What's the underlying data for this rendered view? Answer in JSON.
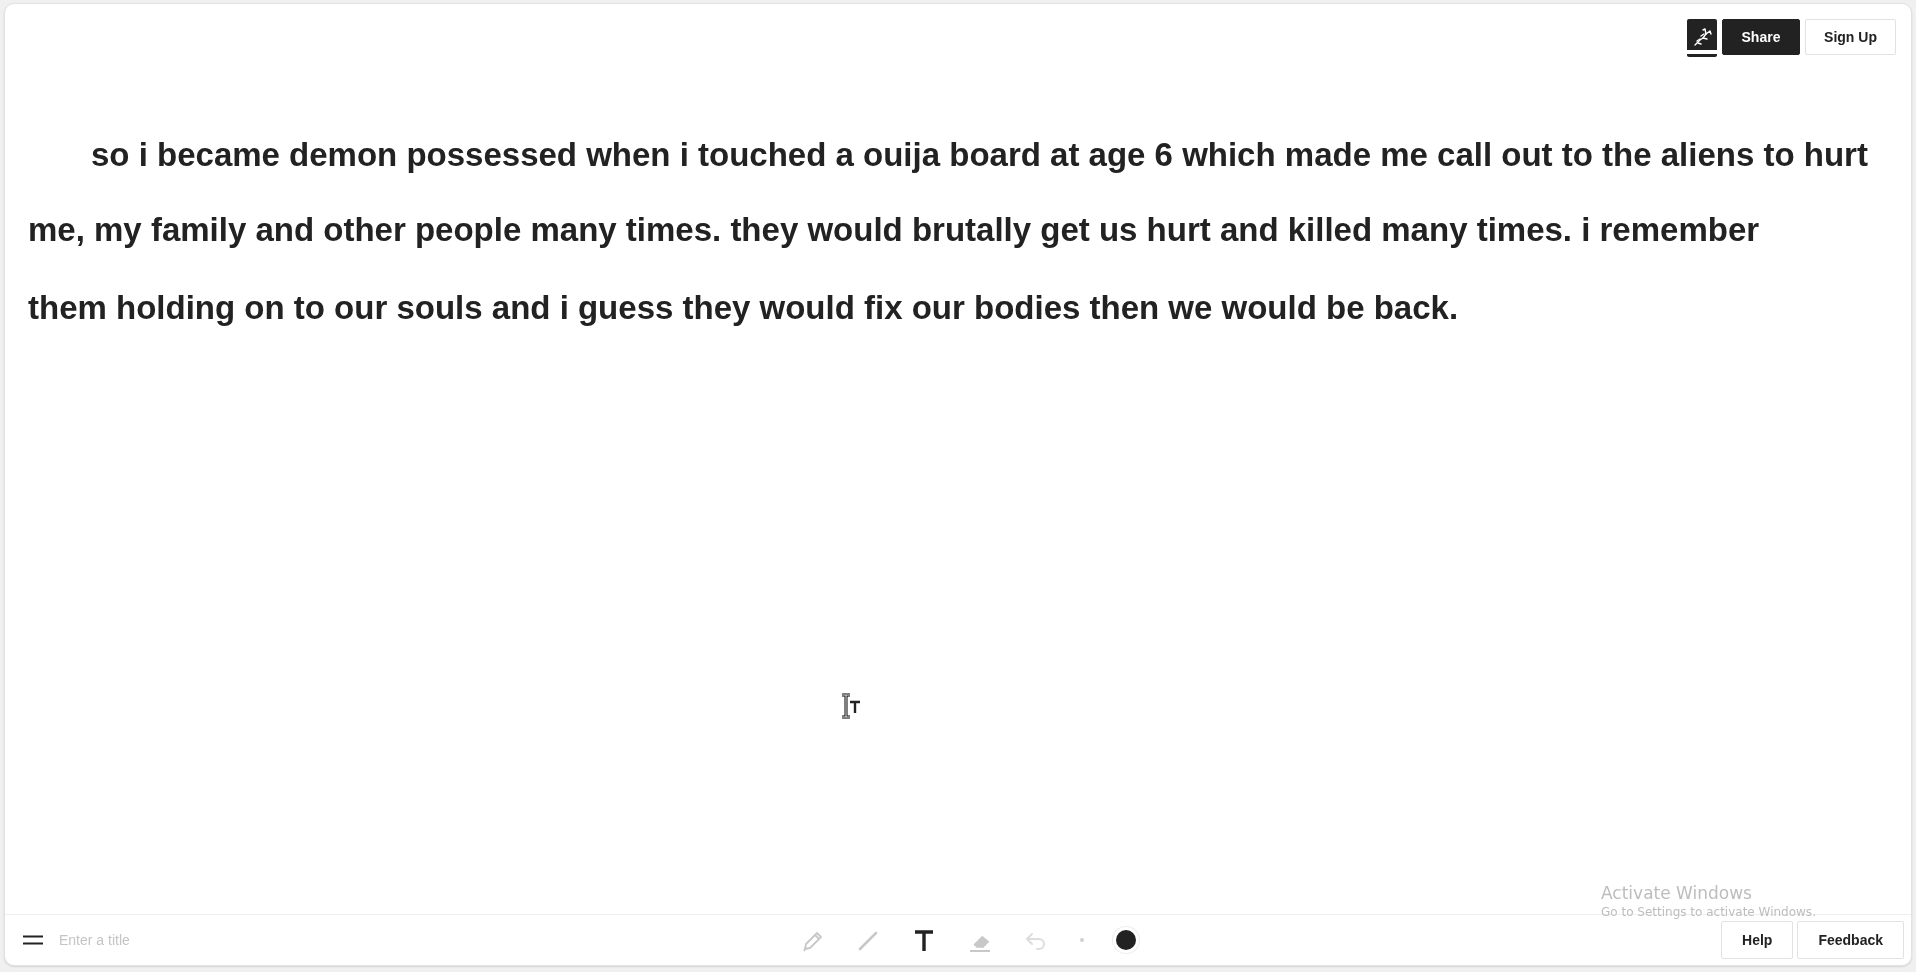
{
  "header": {
    "buttons": [
      {
        "kind": "icon",
        "selected": true
      },
      {
        "kind": "primary",
        "label": "Share"
      },
      {
        "kind": "secondary",
        "label": "Sign Up"
      }
    ]
  },
  "canvas": {
    "lines": [
      {
        "text": "so i became demon possessed when i touched a ouija board at age 6 which made me call out to the aliens to hurt",
        "indent": true
      },
      {
        "text": "me, my family and other people many times. they would brutally get us hurt and killed many times. i remember",
        "indent": false
      },
      {
        "text": "them holding on to our souls and i guess they would fix our bodies then we would be back.",
        "indent": false
      }
    ]
  },
  "toolbar": {
    "title_field": {
      "placeholder": "Enter a title"
    },
    "tools": [
      {
        "kind": "pencil",
        "selected": false,
        "disabled": false
      },
      {
        "kind": "line",
        "selected": false,
        "disabled": false
      },
      {
        "kind": "text",
        "selected": true,
        "disabled": false
      },
      {
        "kind": "eraser",
        "selected": false,
        "disabled": false
      },
      {
        "kind": "undo",
        "selected": false,
        "disabled": true
      },
      {
        "kind": "size"
      },
      {
        "kind": "color",
        "color": "#222222"
      }
    ],
    "buttons": [
      "Help",
      "Feedback"
    ]
  },
  "os_notice": {
    "title": "Activate Windows",
    "subtitle": "Go to Settings to activate Windows."
  }
}
